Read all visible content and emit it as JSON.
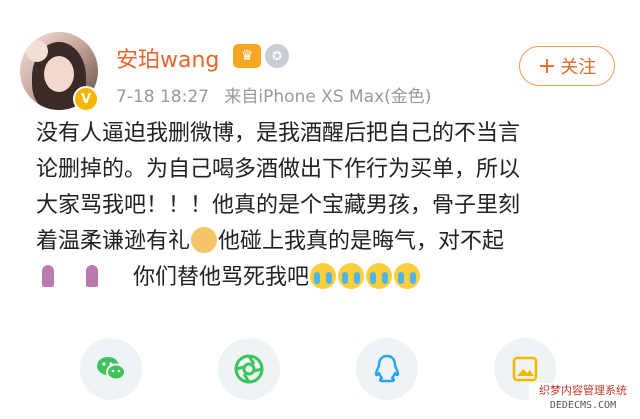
{
  "post": {
    "author": "安珀wang",
    "timestamp": "7-18 18:27",
    "source": "来自iPhone XS Max(金色)",
    "follow_label": "关注",
    "follow_icon": "+",
    "lines": [
      "没有人逼迫我删微博，是我酒醒后把自己的不当言",
      "论删掉的。为自己喝多酒做出下作行为买单，所以",
      "大家骂我吧！！！他真的是个宝藏男孩，骨子里刻"
    ],
    "line4_part1": "着温柔谦逊有礼",
    "line4_part2": "他碰上我真的是晦气，对不起",
    "line5": "你们替他骂死我吧"
  },
  "badges": {
    "verified": "V"
  },
  "share": [
    {
      "name": "wechat",
      "color": "#3ec35b"
    },
    {
      "name": "moments",
      "color": "#3ec35b"
    },
    {
      "name": "qq",
      "color": "#2aa3f0"
    },
    {
      "name": "qzone",
      "color": "#f5b800"
    }
  ],
  "watermark": {
    "line1": "织梦内容管理系统",
    "line2": "DEDECMS.COM"
  }
}
